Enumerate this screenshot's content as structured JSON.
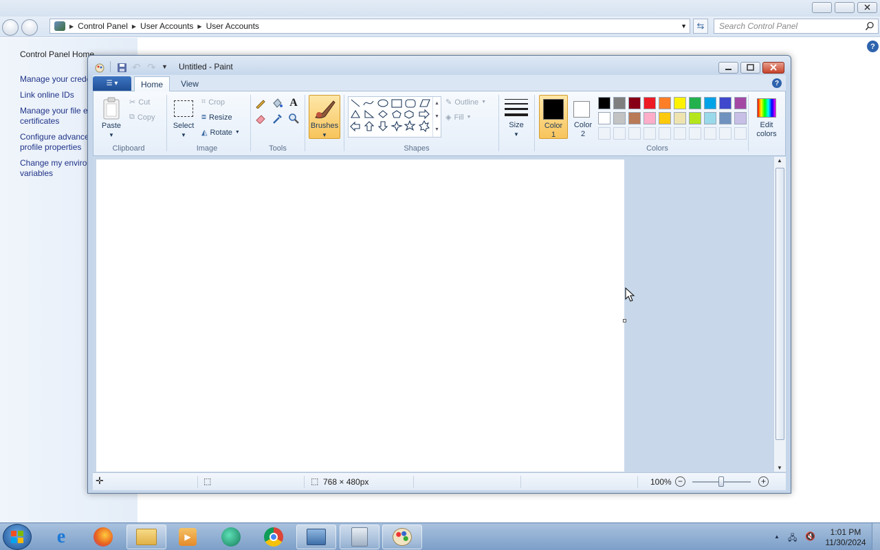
{
  "control_panel": {
    "breadcrumb": [
      "Control Panel",
      "User Accounts",
      "User Accounts"
    ],
    "search_placeholder": "Search Control Panel",
    "sidebar": {
      "home": "Control Panel Home",
      "links": [
        {
          "line1": "Manage your crede",
          "line2": ""
        },
        {
          "line1": "Link online IDs",
          "line2": ""
        },
        {
          "line1": "Manage your file e",
          "line2": "certificates"
        },
        {
          "line1": "Configure advance",
          "line2": "profile properties"
        },
        {
          "line1": "Change my enviro",
          "line2": "variables"
        }
      ]
    },
    "help_glyph": "?"
  },
  "paint": {
    "title": "Untitled - Paint",
    "tabs": {
      "home": "Home",
      "view": "View"
    },
    "clipboard": {
      "paste": "Paste",
      "cut": "Cut",
      "copy": "Copy",
      "group": "Clipboard"
    },
    "image": {
      "select": "Select",
      "crop": "Crop",
      "resize": "Resize",
      "rotate": "Rotate",
      "group": "Image"
    },
    "tools": {
      "group": "Tools"
    },
    "brushes": {
      "label": "Brushes"
    },
    "shapes": {
      "outline": "Outline",
      "fill": "Fill",
      "group": "Shapes"
    },
    "size": {
      "label": "Size"
    },
    "color1": {
      "line1": "Color",
      "line2": "1",
      "value": "#000000"
    },
    "color2": {
      "line1": "Color",
      "line2": "2",
      "value": "#ffffff"
    },
    "colors": {
      "group": "Colors",
      "edit_line1": "Edit",
      "edit_line2": "colors",
      "row1": [
        "#000000",
        "#7f7f7f",
        "#880015",
        "#ed1c24",
        "#ff7f27",
        "#fff200",
        "#22b14c",
        "#00a2e8",
        "#3f48cc",
        "#a349a4"
      ],
      "row2": [
        "#ffffff",
        "#c3c3c3",
        "#b97a57",
        "#ffaec9",
        "#ffc90e",
        "#efe4b0",
        "#b5e61d",
        "#99d9ea",
        "#7092be",
        "#c8bfe7"
      ]
    },
    "status": {
      "dimensions": "768 × 480px",
      "zoom": "100%"
    }
  },
  "taskbar": {
    "time": "1:01 PM",
    "date": "11/30/2024",
    "apps": [
      "internet-explorer",
      "firefox",
      "file-explorer",
      "media-player",
      "app-circle",
      "chrome",
      "control-panel",
      "recycle-app",
      "paint"
    ]
  }
}
